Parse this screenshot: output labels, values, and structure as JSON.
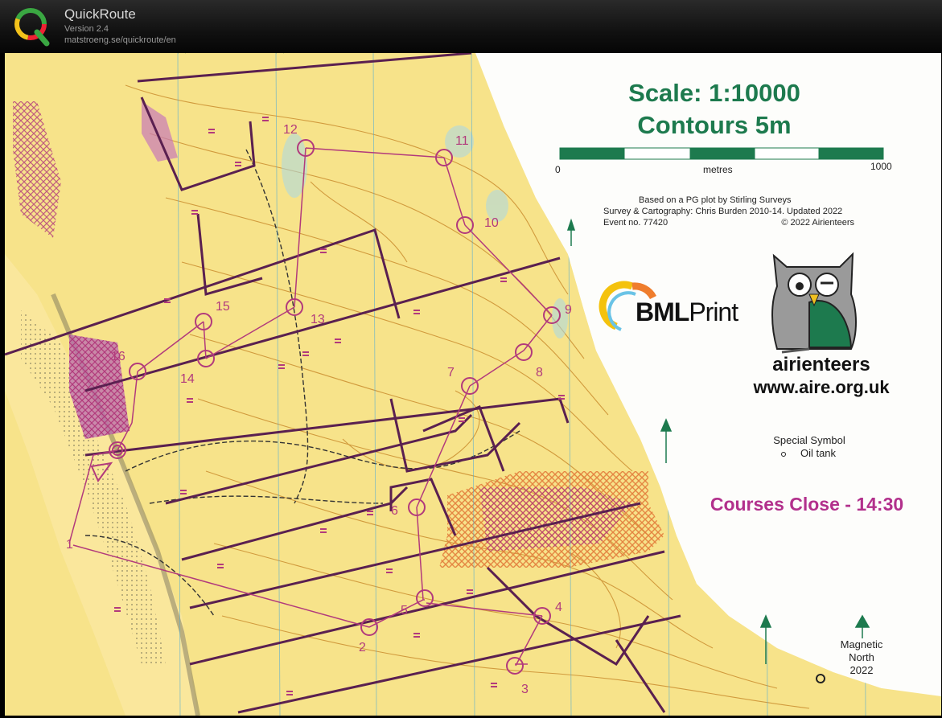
{
  "app": {
    "name": "QuickRoute",
    "version": "Version 2.4",
    "url": "matstroeng.se/quickroute/en"
  },
  "map": {
    "scale_title": "Scale: 1:10000",
    "contours_title": "Contours 5m",
    "scale_bar": {
      "start": "0",
      "unit": "metres",
      "end": "1000"
    },
    "credits": {
      "line1": "Based on a PG plot by Stirling Surveys",
      "line2": "Survey & Cartography: Chris Burden 2010-14.  Updated 2022",
      "line3_left": "Event no.  77420",
      "line3_right": "© 2022 Airienteers"
    },
    "sponsor": {
      "brand_bold": "BML",
      "brand_light": "Print"
    },
    "club": {
      "name": "airienteers",
      "website": "www.aire.org.uk"
    },
    "special_symbol": {
      "title": "Special Symbol",
      "item": "Oil tank"
    },
    "courses_close": "Courses Close - 14:30",
    "north": {
      "line1": "Magnetic",
      "line2": "North",
      "line3": "2022"
    },
    "controls": [
      {
        "id": "1",
        "label": "1"
      },
      {
        "id": "2",
        "label": "2"
      },
      {
        "id": "3",
        "label": "3"
      },
      {
        "id": "4",
        "label": "4"
      },
      {
        "id": "5",
        "label": "5"
      },
      {
        "id": "6",
        "label": "6"
      },
      {
        "id": "7",
        "label": "7"
      },
      {
        "id": "8",
        "label": "8"
      },
      {
        "id": "9",
        "label": "9"
      },
      {
        "id": "10",
        "label": "10"
      },
      {
        "id": "11",
        "label": "11"
      },
      {
        "id": "12",
        "label": "12"
      },
      {
        "id": "13",
        "label": "13"
      },
      {
        "id": "14",
        "label": "14"
      },
      {
        "id": "15",
        "label": "15"
      },
      {
        "id": "16",
        "label": "16"
      }
    ],
    "colors": {
      "terrain": "#f7e38a",
      "contour": "#c8892a",
      "course": "#b23a7c",
      "boundary": "#5a2050",
      "accent_green": "#1d7a4e"
    }
  }
}
